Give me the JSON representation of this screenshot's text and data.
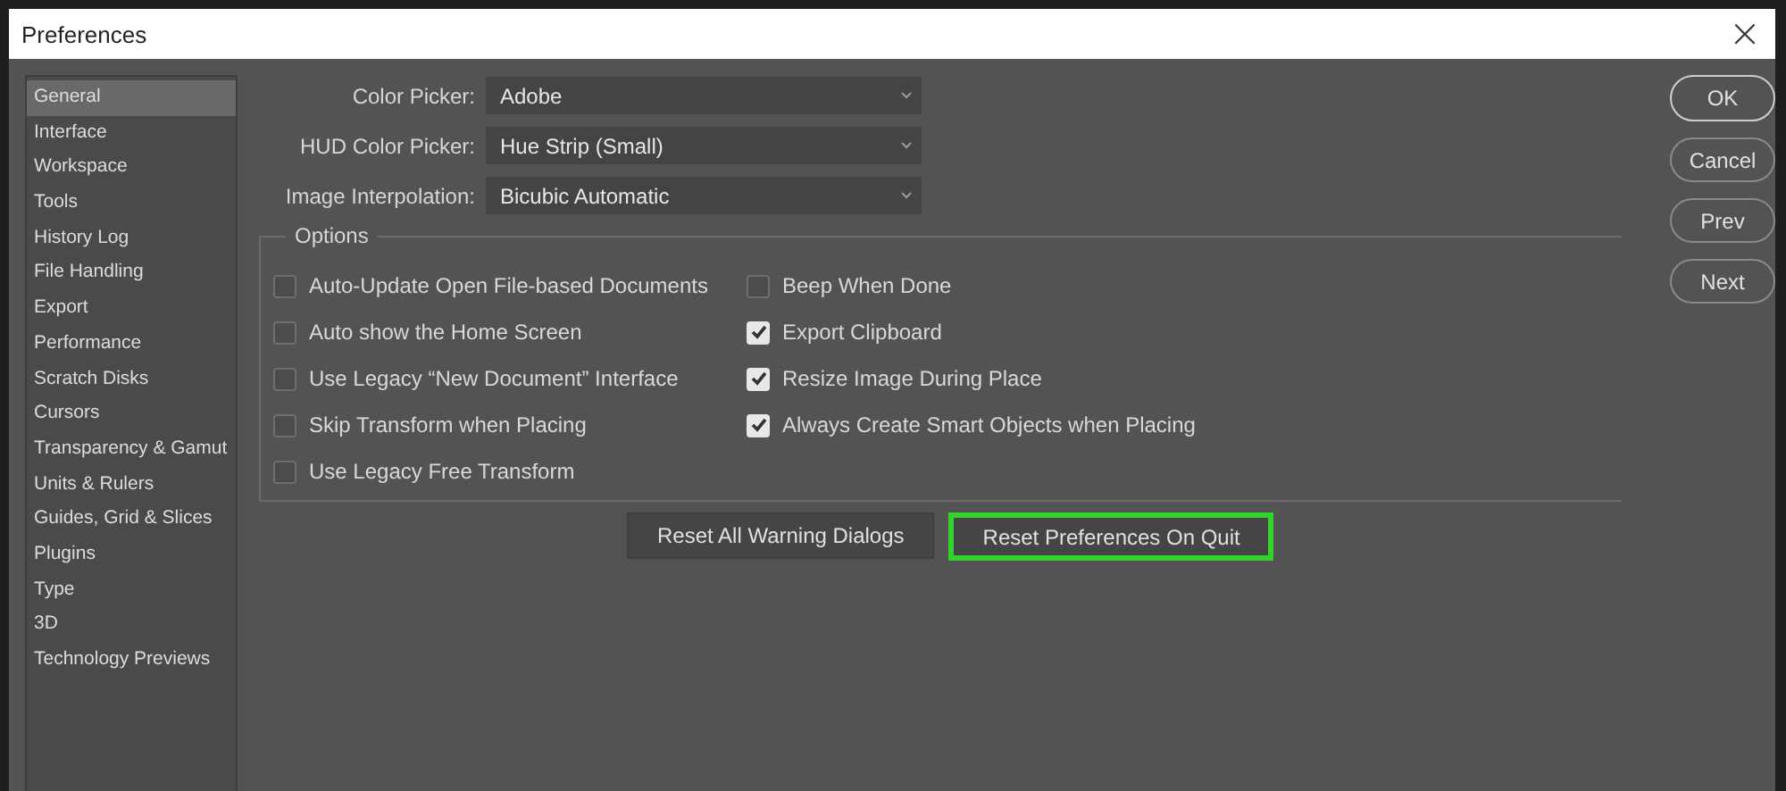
{
  "window": {
    "title": "Preferences",
    "close": "×"
  },
  "sidebar": {
    "items": [
      {
        "label": "General",
        "selected": true
      },
      {
        "label": "Interface",
        "selected": false
      },
      {
        "label": "Workspace",
        "selected": false
      },
      {
        "label": "Tools",
        "selected": false
      },
      {
        "label": "History Log",
        "selected": false
      },
      {
        "label": "File Handling",
        "selected": false
      },
      {
        "label": "Export",
        "selected": false
      },
      {
        "label": "Performance",
        "selected": false
      },
      {
        "label": "Scratch Disks",
        "selected": false
      },
      {
        "label": "Cursors",
        "selected": false
      },
      {
        "label": "Transparency & Gamut",
        "selected": false
      },
      {
        "label": "Units & Rulers",
        "selected": false
      },
      {
        "label": "Guides, Grid & Slices",
        "selected": false
      },
      {
        "label": "Plugins",
        "selected": false
      },
      {
        "label": "Type",
        "selected": false
      },
      {
        "label": "3D",
        "selected": false
      },
      {
        "label": "Technology Previews",
        "selected": false
      }
    ]
  },
  "fields": [
    {
      "label": "Color Picker:",
      "value": "Adobe"
    },
    {
      "label": "HUD Color Picker:",
      "value": "Hue Strip (Small)"
    },
    {
      "label": "Image Interpolation:",
      "value": "Bicubic Automatic"
    }
  ],
  "options": {
    "title": "Options",
    "columns": [
      [
        {
          "label": "Auto-Update Open File-based Documents",
          "checked": false
        },
        {
          "label": "Auto show the Home Screen",
          "checked": false
        },
        {
          "label": "Use Legacy “New Document” Interface",
          "checked": false
        },
        {
          "label": "Skip Transform when Placing",
          "checked": false
        },
        {
          "label": "Use Legacy Free Transform",
          "checked": false
        }
      ],
      [
        {
          "label": "Beep When Done",
          "checked": false
        },
        {
          "label": "Export Clipboard",
          "checked": true
        },
        {
          "label": "Resize Image During Place",
          "checked": true
        },
        {
          "label": "Always Create Smart Objects when Placing",
          "checked": true
        }
      ]
    ]
  },
  "reset_buttons": [
    {
      "label": "Reset All Warning Dialogs",
      "highlighted": false
    },
    {
      "label": "Reset Preferences On Quit",
      "highlighted": true
    }
  ],
  "dialog_buttons": [
    {
      "label": "OK",
      "default": true
    },
    {
      "label": "Cancel",
      "default": false
    },
    {
      "label": "Prev",
      "default": false
    },
    {
      "label": "Next",
      "default": false
    }
  ]
}
